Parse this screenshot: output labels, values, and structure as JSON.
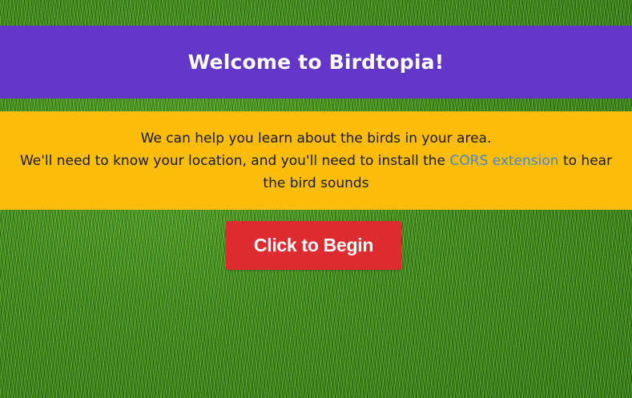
{
  "header": {
    "title": "Welcome to Birdtopia!"
  },
  "info": {
    "line1": "We can help you learn about the birds in your area.",
    "line2_before": "We'll need to know your location, and you'll need to install the ",
    "link_text": "CORS extension",
    "line2_after": " to hear the bird sounds"
  },
  "actions": {
    "begin_label": "Click to Begin"
  },
  "colors": {
    "header_bg": "#6236c9",
    "info_bg": "#fbbd09",
    "link": "#4a86c9",
    "button_bg": "#dd2b2f"
  }
}
